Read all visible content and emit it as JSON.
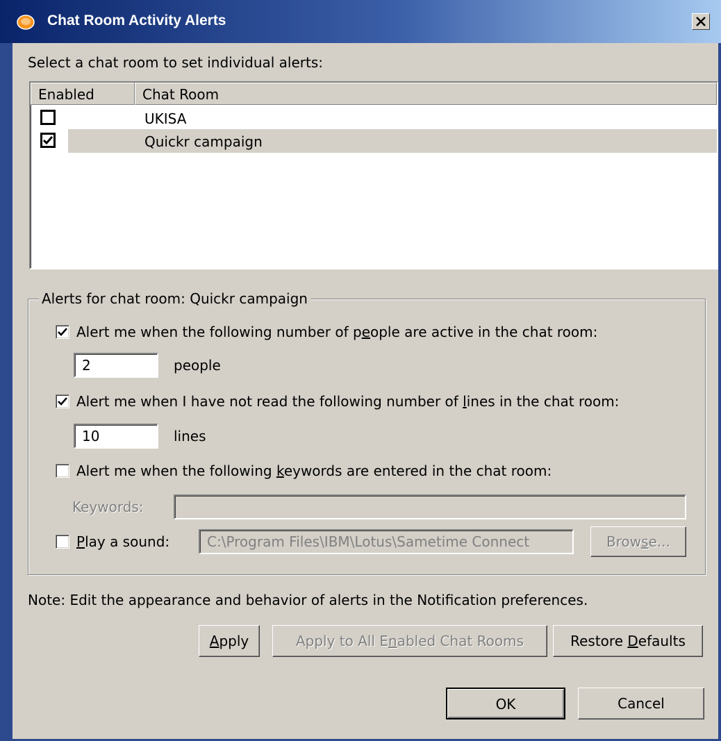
{
  "window": {
    "title": "Chat Room Activity Alerts",
    "close_label": "X"
  },
  "intro_label": "Select a chat room to set individual alerts:",
  "table": {
    "columns": [
      "Enabled",
      "Chat Room"
    ],
    "rows": [
      {
        "enabled": false,
        "name": "UKISA",
        "selected": false
      },
      {
        "enabled": true,
        "name": "Quickr campaign",
        "selected": true
      }
    ]
  },
  "alerts": {
    "group_title": "Alerts for chat room: Quickr campaign",
    "people": {
      "checked": true,
      "label_pre": "Alert me when the following number of p",
      "label_u": "e",
      "label_post": "ople are active in the chat room:",
      "value": "2",
      "unit": "people"
    },
    "lines": {
      "checked": true,
      "label_pre": "Alert me when I have not read the following number of ",
      "label_u": "l",
      "label_post": "ines in the chat room:",
      "value": "10",
      "unit": "lines"
    },
    "keywords": {
      "checked": false,
      "label_pre": "Alert me when the following ",
      "label_u": "k",
      "label_post": "eywords are entered in the chat room:",
      "field_label": "Keywords:",
      "value": ""
    },
    "sound": {
      "checked": false,
      "label_u": "P",
      "label_post": "lay a sound:",
      "path": "C:\\Program Files\\IBM\\Lotus\\Sametime Connect",
      "browse_pre": "Brow",
      "browse_u": "s",
      "browse_post": "e..."
    }
  },
  "note": "Note: Edit the appearance and behavior of alerts in the Notification preferences.",
  "buttons": {
    "apply_u": "A",
    "apply_post": "pply",
    "apply_all_pre": "Apply to All E",
    "apply_all_u": "n",
    "apply_all_post": "abled Chat Rooms",
    "restore_pre": "Restore ",
    "restore_u": "D",
    "restore_post": "efaults",
    "ok": "OK",
    "cancel": "Cancel"
  }
}
